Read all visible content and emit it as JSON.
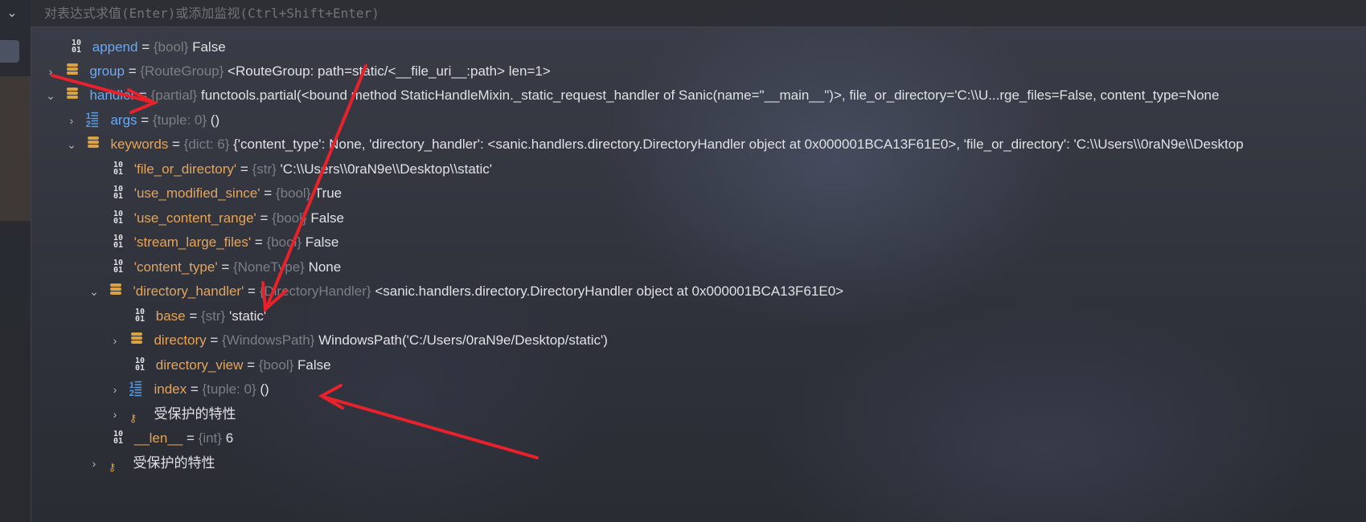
{
  "expression_bar": {
    "placeholder": "对表达式求值(Enter)或添加监视(Ctrl+Shift+Enter)"
  },
  "colors": {
    "name": "#6aa9f5",
    "dict_key": "#e5a45a",
    "type": "#7b7e85",
    "annotation_arrow": "#e8212b"
  },
  "icons": {
    "primitive": "binary-value-icon",
    "object": "object-icon",
    "list": "list-icon",
    "protected": "key-icon",
    "expand": "chevron-right-icon",
    "collapse": "chevron-down-icon"
  },
  "tree": [
    {
      "name": "append",
      "type": "{bool}",
      "value": "False"
    },
    {
      "name": "group",
      "type": "{RouteGroup}",
      "value": "<RouteGroup: path=static/<__file_uri__:path> len=1>"
    },
    {
      "name": "handler",
      "type": "{partial}",
      "value": "functools.partial(<bound method StaticHandleMixin._static_request_handler of Sanic(name=\"__main__\")>, file_or_directory='C:\\\\U...rge_files=False, content_type=None"
    },
    {
      "name": "args",
      "type": "{tuple: 0}",
      "value": "()"
    },
    {
      "name": "keywords",
      "type": "{dict: 6}",
      "value": "{'content_type': None, 'directory_handler': <sanic.handlers.directory.DirectoryHandler object at 0x000001BCA13F61E0>, 'file_or_directory': 'C:\\\\Users\\\\0raN9e\\\\Desktop"
    },
    {
      "name": "'file_or_directory'",
      "type": "{str}",
      "value": "'C:\\\\Users\\\\0raN9e\\\\Desktop\\\\static'"
    },
    {
      "name": "'use_modified_since'",
      "type": "{bool}",
      "value": "True"
    },
    {
      "name": "'use_content_range'",
      "type": "{bool}",
      "value": "False"
    },
    {
      "name": "'stream_large_files'",
      "type": "{bool}",
      "value": "False"
    },
    {
      "name": "'content_type'",
      "type": "{NoneType}",
      "value": "None"
    },
    {
      "name": "'directory_handler'",
      "type": "{DirectoryHandler}",
      "value": "<sanic.handlers.directory.DirectoryHandler object at 0x000001BCA13F61E0>"
    },
    {
      "name": "base",
      "type": "{str}",
      "value": "'static'"
    },
    {
      "name": "directory",
      "type": "{WindowsPath}",
      "value": "WindowsPath('C:/Users/0raN9e/Desktop/static')"
    },
    {
      "name": "directory_view",
      "type": "{bool}",
      "value": "False"
    },
    {
      "name": "index",
      "type": "{tuple: 0}",
      "value": "()"
    },
    {
      "label": "受保护的特性"
    },
    {
      "name": "__len__",
      "type": "{int}",
      "value": "6"
    },
    {
      "label": "受保护的特性"
    }
  ]
}
